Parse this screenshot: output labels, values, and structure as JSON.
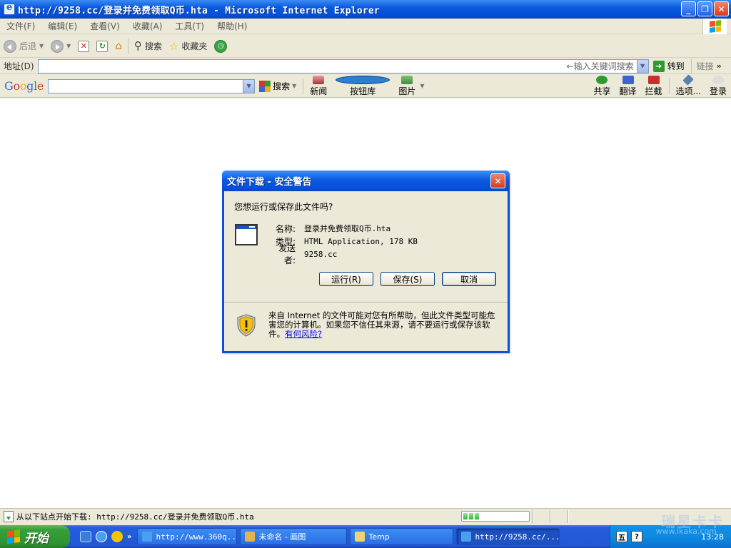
{
  "window": {
    "title": "http://9258.cc/登录并免费领取Q币.hta - Microsoft Internet Explorer",
    "minimize": "_",
    "maximize": "❐",
    "close": "✕"
  },
  "menu": {
    "items": [
      "文件(F)",
      "编辑(E)",
      "查看(V)",
      "收藏(A)",
      "工具(T)",
      "帮助(H)"
    ]
  },
  "toolbar": {
    "back": "后退",
    "search": "搜索",
    "favorites": "收藏夹"
  },
  "address": {
    "label": "地址(D)",
    "value": "",
    "placeholder": "←输入关键词搜索",
    "go": "转到",
    "links": "链接",
    "more": "»"
  },
  "google": {
    "logo": [
      "G",
      "o",
      "o",
      "g",
      "l",
      "e"
    ],
    "search": "搜索",
    "news": "新闻",
    "buttons": "按钮库",
    "images": "图片",
    "share": "共享",
    "translate": "翻译",
    "block": "拦截",
    "options": "选项...",
    "login": "登录"
  },
  "dialog": {
    "title": "文件下载 - 安全警告",
    "question": "您想运行或保存此文件吗?",
    "name_label": "名称:",
    "name_value": "登录并免费领取Q币.hta",
    "type_label": "类型:",
    "type_value": "HTML Application, 178 KB",
    "from_label": "发送者:",
    "from_value": "9258.cc",
    "run": "运行(R)",
    "save": "保存(S)",
    "cancel": "取消",
    "warning": "来自 Internet 的文件可能对您有所帮助，但此文件类型可能危害您的计算机。如果您不信任其来源，请不要运行或保存该软件。",
    "risk_link": "有何风险?"
  },
  "status": {
    "text": "从以下站点开始下载: http://9258.cc/登录并免费领取Q币.hta",
    "progress": 0.12
  },
  "taskbar": {
    "start": "开始",
    "more": "»",
    "tasks": [
      {
        "label": "http://www.360q...",
        "active": false
      },
      {
        "label": "未命名 - 画图",
        "active": false
      },
      {
        "label": "Temp",
        "active": false
      },
      {
        "label": "http://9258.cc/...",
        "active": true
      }
    ],
    "tray_icons": [
      "五",
      "?"
    ],
    "clock": "13:28"
  },
  "watermark": {
    "text": "瑞星卡卡",
    "url": "www.ikaka.com"
  }
}
